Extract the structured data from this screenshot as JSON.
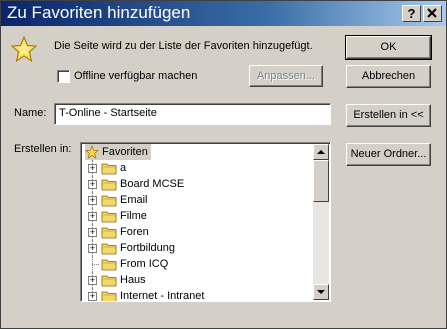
{
  "window": {
    "title": "Zu Favoriten hinzufügen"
  },
  "titlebar_buttons": {
    "help": "?",
    "close": "X"
  },
  "message": "Die Seite wird zu der Liste der Favoriten hinzugefügt.",
  "offline": {
    "label": "Offline verfügbar machen",
    "checked": false
  },
  "buttons": {
    "ok": "OK",
    "cancel": "Abbrechen",
    "customize": "Anpassen...",
    "create_in": "Erstellen in <<",
    "new_folder": "Neuer Ordner..."
  },
  "name": {
    "label": "Name:",
    "value": "T-Online - Startseite"
  },
  "create_in_label": "Erstellen in:",
  "tree": {
    "root": "Favoriten",
    "items": [
      {
        "label": "a",
        "expandable": true
      },
      {
        "label": "Board MCSE",
        "expandable": true
      },
      {
        "label": "Email",
        "expandable": true
      },
      {
        "label": "Filme",
        "expandable": true
      },
      {
        "label": "Foren",
        "expandable": true
      },
      {
        "label": "Fortbildung",
        "expandable": true
      },
      {
        "label": "From ICQ",
        "expandable": false
      },
      {
        "label": "Haus",
        "expandable": true
      },
      {
        "label": "Internet - Intranet",
        "expandable": true
      }
    ]
  },
  "colors": {
    "titlebar_start": "#0a246a",
    "titlebar_end": "#a6caf0",
    "face": "#d4d0c8",
    "folder": "#f6d66a"
  }
}
